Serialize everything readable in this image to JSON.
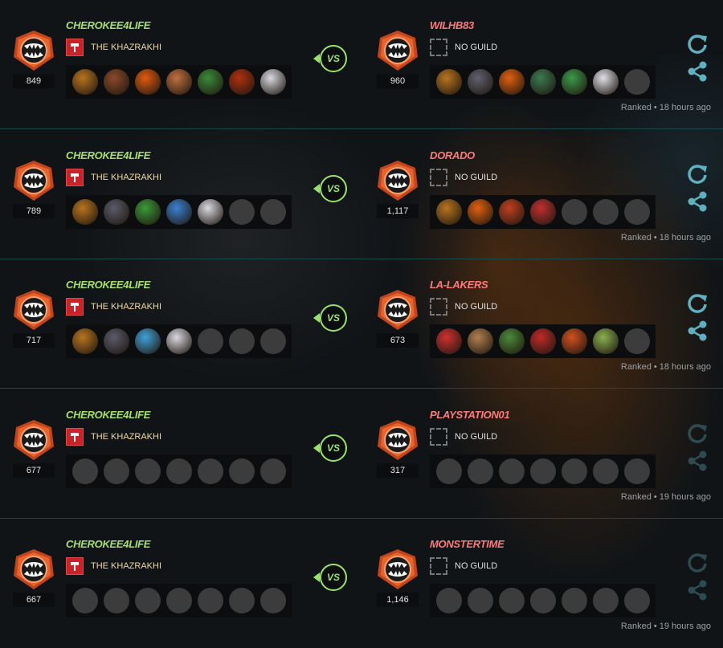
{
  "colors": {
    "left_name": "#a6e06b",
    "right_name": "#ff7a7a",
    "vs": "#9ae36a",
    "action": "#5fb0c0",
    "badge": "#e8642c"
  },
  "icons": {
    "emblem": "fang-emblem-icon",
    "guild": "hammer-banner-icon",
    "no_guild": "empty-guild-icon",
    "replay": "replay-icon",
    "share": "share-icon"
  },
  "vs_label": "VS",
  "matches": [
    {
      "left": {
        "name": "CHEROKEE4LIFE",
        "guild": "THE KHAZRAKHI",
        "rating": "849",
        "heroes": [
          "#b8741f",
          "#8a4a2a",
          "#e05a10",
          "#c07040",
          "#3a8a3a",
          "#b03010",
          "#d8d8e0"
        ]
      },
      "right": {
        "name": "WILHB83",
        "guild": "NO GUILD",
        "rating": "960",
        "heroes": [
          "#b8741f",
          "#606070",
          "#e06010",
          "#3a7a50",
          "#3a9a4a",
          "#e0e0e8",
          ""
        ]
      },
      "meta": "Ranked • 18 hours ago",
      "actions_enabled": true
    },
    {
      "left": {
        "name": "CHEROKEE4LIFE",
        "guild": "THE KHAZRAKHI",
        "rating": "789",
        "heroes": [
          "#b8741f",
          "#5a5a6a",
          "#3a9a3a",
          "#3a80d0",
          "#d8d8e0",
          "",
          ""
        ]
      },
      "right": {
        "name": "DORADO",
        "guild": "NO GUILD",
        "rating": "1,117",
        "heroes": [
          "#b8741f",
          "#e06010",
          "#c04020",
          "#c03030",
          "",
          "",
          ""
        ]
      },
      "meta": "Ranked • 18 hours ago",
      "actions_enabled": true
    },
    {
      "left": {
        "name": "CHEROKEE4LIFE",
        "guild": "THE KHAZRAKHI",
        "rating": "717",
        "heroes": [
          "#b8741f",
          "#5a5a6a",
          "#40a0d8",
          "#d8d8e0",
          "",
          "",
          ""
        ]
      },
      "right": {
        "name": "LA-LAKERS",
        "guild": "NO GUILD",
        "rating": "673",
        "heroes": [
          "#d03030",
          "#b08050",
          "#4a8a3a",
          "#c02a2a",
          "#d05020",
          "#8ab050",
          ""
        ]
      },
      "meta": "Ranked • 18 hours ago",
      "actions_enabled": true
    },
    {
      "left": {
        "name": "CHEROKEE4LIFE",
        "guild": "THE KHAZRAKHI",
        "rating": "677",
        "heroes": [
          "",
          "",
          "",
          "",
          "",
          "",
          ""
        ]
      },
      "right": {
        "name": "PLAYSTATION01",
        "guild": "NO GUILD",
        "rating": "317",
        "heroes": [
          "",
          "",
          "",
          "",
          "",
          "",
          ""
        ]
      },
      "meta": "Ranked • 19 hours ago",
      "actions_enabled": false
    },
    {
      "left": {
        "name": "CHEROKEE4LIFE",
        "guild": "THE KHAZRAKHI",
        "rating": "667",
        "heroes": [
          "",
          "",
          "",
          "",
          "",
          "",
          ""
        ]
      },
      "right": {
        "name": "MONSTERTIME",
        "guild": "NO GUILD",
        "rating": "1,146",
        "heroes": [
          "",
          "",
          "",
          "",
          "",
          "",
          ""
        ]
      },
      "meta": "Ranked • 19 hours ago",
      "actions_enabled": false
    }
  ]
}
